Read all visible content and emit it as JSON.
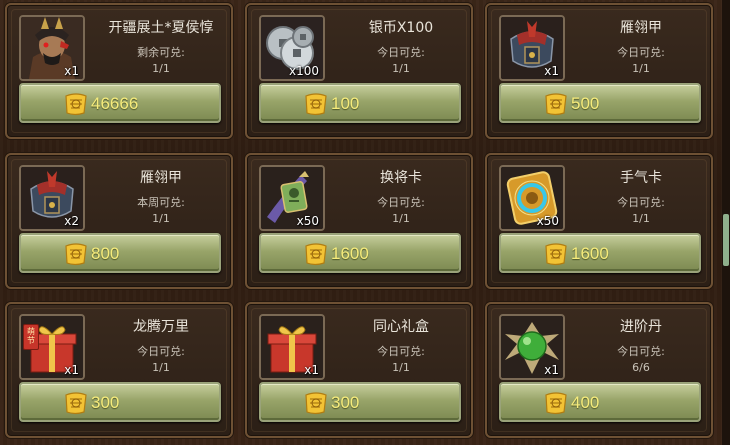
{
  "items": [
    {
      "name": "开疆展土*夏侯惇",
      "limit_label": "剩余可兑:",
      "count": "1/1",
      "qty": "x1",
      "price": "46666",
      "icon": "general-portrait-icon"
    },
    {
      "name": "银币X100",
      "limit_label": "今日可兑:",
      "count": "1/1",
      "qty": "x100",
      "price": "100",
      "icon": "silver-coins-icon"
    },
    {
      "name": "雁翎甲",
      "limit_label": "今日可兑:",
      "count": "1/1",
      "qty": "x1",
      "price": "500",
      "icon": "armor-icon"
    },
    {
      "name": "雁翎甲",
      "limit_label": "本周可兑:",
      "count": "1/1",
      "qty": "x2",
      "price": "800",
      "icon": "armor-icon"
    },
    {
      "name": "换将卡",
      "limit_label": "今日可兑:",
      "count": "1/1",
      "qty": "x50",
      "price": "1600",
      "icon": "swap-general-card-icon"
    },
    {
      "name": "手气卡",
      "limit_label": "今日可兑:",
      "count": "1/1",
      "qty": "x50",
      "price": "1600",
      "icon": "luck-card-icon"
    },
    {
      "name": "龙腾万里",
      "limit_label": "今日可兑:",
      "count": "1/1",
      "qty": "x1",
      "price": "300",
      "icon": "gift-box-icon",
      "badge": "萌节"
    },
    {
      "name": "同心礼盒",
      "limit_label": "今日可兑:",
      "count": "1/1",
      "qty": "x1",
      "price": "300",
      "icon": "gift-box-icon"
    },
    {
      "name": "进阶丹",
      "limit_label": "今日可兑:",
      "count": "6/6",
      "qty": "x1",
      "price": "400",
      "icon": "advance-pill-icon"
    }
  ],
  "currency_icon": "gold-scroll-icon",
  "colors": {
    "price": "#f6ec7c",
    "button": "#98a469",
    "card_border": "#6e5134"
  }
}
